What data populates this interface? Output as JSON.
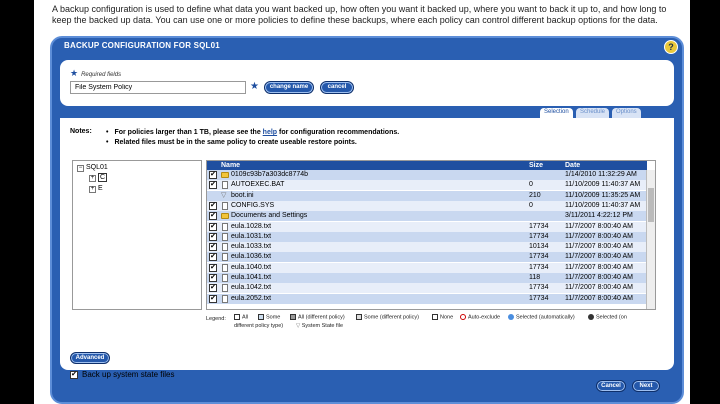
{
  "intro_text": "A backup configuration is used to define what data you want backed up, how often you want it backed up, where you want to back it up to, and how long to keep the backed up data. You can use one or more policies to define these backups, where each policy can control different backup options for the data.",
  "dialog": {
    "title": "BACKUP CONFIGURATION FOR SQL01",
    "help_label": "?"
  },
  "form": {
    "required_label": "Required fields",
    "policy_name_value": "File System Policy",
    "change_name_label": "change name",
    "cancel_small_label": "cancel"
  },
  "tabs": [
    "Selection",
    "Schedule",
    "Options"
  ],
  "notes": {
    "label": "Notes:",
    "line1_before": "For policies larger than 1 TB, please see the ",
    "line1_link": "help",
    "line1_after": " for configuration recommendations.",
    "line2": "Related files must be in the same policy to create useable restore points."
  },
  "tree": {
    "root": "SQL01",
    "children": [
      "C",
      "E"
    ]
  },
  "grid": {
    "headers": {
      "name": "Name",
      "size": "Size",
      "date": "Date"
    },
    "rows": [
      {
        "name": "0109c93b7a303dc8774b",
        "size": "",
        "date": "1/14/2010 11:32:29 AM",
        "type": "folder",
        "check": "✔"
      },
      {
        "name": "AUTOEXEC.BAT",
        "size": "0",
        "date": "11/10/2009 11:40:37 AM",
        "type": "file",
        "check": "✔"
      },
      {
        "name": "boot.ini",
        "size": "210",
        "date": "11/10/2009 11:35:25 AM",
        "type": "system",
        "check": ""
      },
      {
        "name": "CONFIG.SYS",
        "size": "0",
        "date": "11/10/2009 11:40:37 AM",
        "type": "file",
        "check": "✔"
      },
      {
        "name": "Documents and Settings",
        "size": "",
        "date": "3/11/2011 4:22:12 PM",
        "type": "folder",
        "check": "✔"
      },
      {
        "name": "eula.1028.txt",
        "size": "17734",
        "date": "11/7/2007 8:00:40 AM",
        "type": "file",
        "check": "✔"
      },
      {
        "name": "eula.1031.txt",
        "size": "17734",
        "date": "11/7/2007 8:00:40 AM",
        "type": "file",
        "check": "✔"
      },
      {
        "name": "eula.1033.txt",
        "size": "10134",
        "date": "11/7/2007 8:00:40 AM",
        "type": "file",
        "check": "✔"
      },
      {
        "name": "eula.1036.txt",
        "size": "17734",
        "date": "11/7/2007 8:00:40 AM",
        "type": "file",
        "check": "✔"
      },
      {
        "name": "eula.1040.txt",
        "size": "17734",
        "date": "11/7/2007 8:00:40 AM",
        "type": "file",
        "check": "✔"
      },
      {
        "name": "eula.1041.txt",
        "size": "118",
        "date": "11/7/2007 8:00:40 AM",
        "type": "file",
        "check": "✔"
      },
      {
        "name": "eula.1042.txt",
        "size": "17734",
        "date": "11/7/2007 8:00:40 AM",
        "type": "file",
        "check": "✔"
      },
      {
        "name": "eula.2052.txt",
        "size": "17734",
        "date": "11/7/2007 8:00:40 AM",
        "type": "file",
        "check": "✔"
      }
    ]
  },
  "legend": {
    "label": "Legend:",
    "all": "All",
    "some": "Some",
    "all_diff": "All (different policy)",
    "some_diff": "Some (different policy)",
    "none": "None",
    "auto_exclude": "Auto-exclude",
    "selected_auto": "Selected (automatically)",
    "selected_on_diff_1": "Selected (on",
    "selected_on_diff_2": "different policy type)",
    "system_state": "System State file"
  },
  "system_state": {
    "label": "Back up system state files",
    "checked": "✔"
  },
  "buttons": {
    "advanced": "Advanced",
    "cancel": "Cancel",
    "next": "Next"
  },
  "colors": {
    "accent": "#2a5fb2",
    "row_alt": "#c9d8f0",
    "header": "#1f4fa0"
  }
}
